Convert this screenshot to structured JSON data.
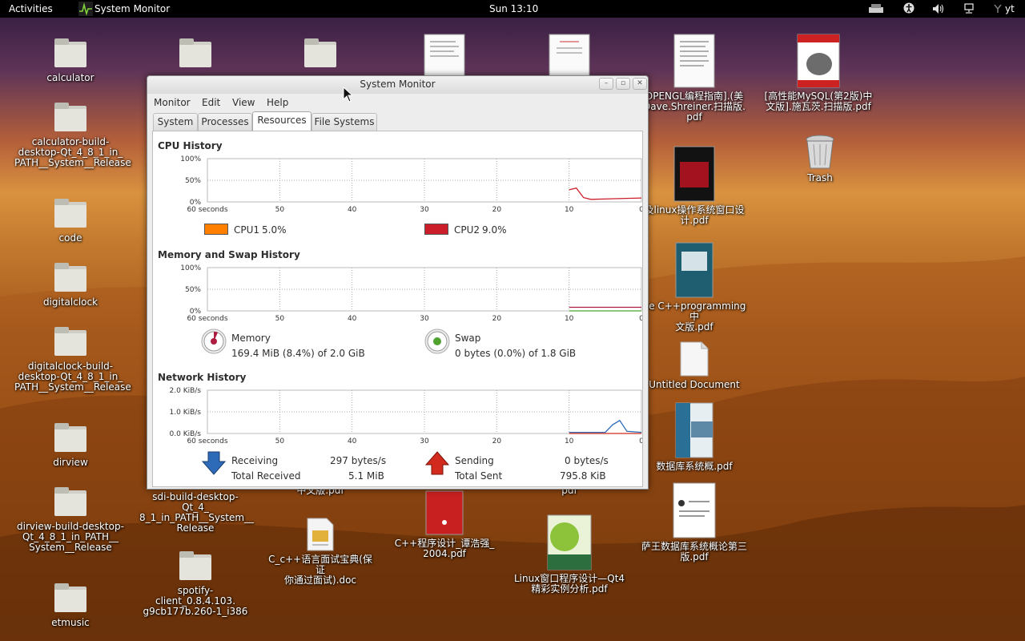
{
  "topbar": {
    "activities": "Activities",
    "app": "System Monitor",
    "clock": "Sun 13:10",
    "user": "yt"
  },
  "desktop": {
    "calculator": "calculator",
    "calc_build": [
      "calculator-build-",
      "desktop-Qt_4_8_1_in_",
      "PATH__System__Release"
    ],
    "code": "code",
    "digitalclock": "digitalclock",
    "dc_build": [
      "digitalclock-build-",
      "desktop-Qt_4_8_1_in_",
      "PATH__System__Release"
    ],
    "dirview": "dirview",
    "dv_build": [
      "dirview-build-desktop-",
      "Qt_4_8_1_in_PATH__",
      "System__Release"
    ],
    "etmusic": "etmusic",
    "sdi": [
      "sdi-build-desktop-Qt_4_",
      "8_1_in_PATH__System__",
      "Release"
    ],
    "spotify": [
      "spotify-client_0.8.4.103.",
      "g9cb177b.260-1_i386"
    ],
    "cdoc": [
      "C_c++语言面试宝典(保证",
      "你通过面试).doc"
    ],
    "cpp_pdf": [
      "C++程序设计_谭浩强_",
      "2004.pdf"
    ],
    "linux_pdf": [
      "Linux窗口程序设计—Qt4",
      "精彩实例分析.pdf"
    ],
    "opengl": [
      "OPENGL编程指南].(美",
      "Dave.Shreiner.扫描版.",
      "pdf"
    ],
    "mysql": [
      "[高性能MySQL(第2版)中",
      "文版].施瓦茨.扫描版.pdf"
    ],
    "trash": "Trash",
    "qt_linux": [
      "及linux操作系统窗口设",
      "计.pdf"
    ],
    "cpp_prog": [
      "he C++programming中",
      "文版.pdf"
    ],
    "untitled": "Untitled Document",
    "db1": "数据库系统概.pdf",
    "db2": [
      "萨王数据库系统概论第三",
      "版.pdf"
    ],
    "partial1": "中文版.pdf",
    "partial2": "pdf"
  },
  "window": {
    "title": "System Monitor",
    "menus": [
      "Monitor",
      "Edit",
      "View",
      "Help"
    ],
    "tabs": [
      "System",
      "Processes",
      "Resources",
      "File Systems"
    ],
    "cpu": {
      "title": "CPU History",
      "ylabels": [
        "100%",
        "50%",
        "0%"
      ],
      "xlabels": [
        "60 seconds",
        "50",
        "40",
        "30",
        "20",
        "10",
        "0"
      ],
      "cpu1_label": "CPU1",
      "cpu1_value": "5.0%",
      "cpu2_label": "CPU2",
      "cpu2_value": "9.0%"
    },
    "mem": {
      "title": "Memory and Swap History",
      "ylabels": [
        "100%",
        "50%",
        "0%"
      ],
      "xlabels": [
        "60 seconds",
        "50",
        "40",
        "30",
        "20",
        "10",
        "0"
      ],
      "memory_label": "Memory",
      "memory_value": "169.4 MiB (8.4%) of 2.0 GiB",
      "swap_label": "Swap",
      "swap_value": "0 bytes (0.0%) of 1.8 GiB"
    },
    "net": {
      "title": "Network History",
      "ylabels": [
        "2.0 KiB/s",
        "1.0 KiB/s",
        "0.0 KiB/s"
      ],
      "xlabels": [
        "60 seconds",
        "50",
        "40",
        "30",
        "20",
        "10",
        "0"
      ],
      "receiving_label": "Receiving",
      "receiving_value": "297 bytes/s",
      "total_received_label": "Total Received",
      "total_received_value": "5.1 MiB",
      "sending_label": "Sending",
      "sending_value": "0 bytes/s",
      "total_sent_label": "Total Sent",
      "total_sent_value": "795.8 KiB"
    }
  },
  "colors": {
    "cpu1": "#ff7f00",
    "cpu2": "#cc1d2a",
    "memory": "#ac1d40",
    "swap": "#4fa22e",
    "receiving": "#2d6ab8",
    "sending": "#d22b1e"
  },
  "chart_data": [
    {
      "type": "line",
      "title": "CPU History",
      "x": [
        -60,
        -10,
        -9,
        -8,
        -7,
        0
      ],
      "xlabel": "seconds",
      "series": [
        {
          "name": "CPU2",
          "values": [
            null,
            28,
            32,
            10,
            6,
            9
          ]
        }
      ],
      "ylim": [
        0,
        100
      ]
    },
    {
      "type": "line",
      "title": "Memory and Swap History",
      "x": [
        -10,
        0
      ],
      "series": [
        {
          "name": "Memory",
          "values": [
            8.4,
            8.4
          ]
        },
        {
          "name": "Swap",
          "values": [
            0,
            0
          ]
        }
      ],
      "ylim": [
        0,
        100
      ]
    },
    {
      "type": "line",
      "title": "Network History",
      "x": [
        -10,
        -5,
        -4,
        -3,
        -2,
        0
      ],
      "series": [
        {
          "name": "Receiving",
          "values": [
            0.05,
            0.05,
            0.4,
            0.6,
            0.1,
            0.05
          ]
        },
        {
          "name": "Sending",
          "values": [
            0,
            0,
            0,
            0,
            0,
            0
          ]
        }
      ],
      "ylim": [
        0,
        2.0
      ]
    }
  ]
}
